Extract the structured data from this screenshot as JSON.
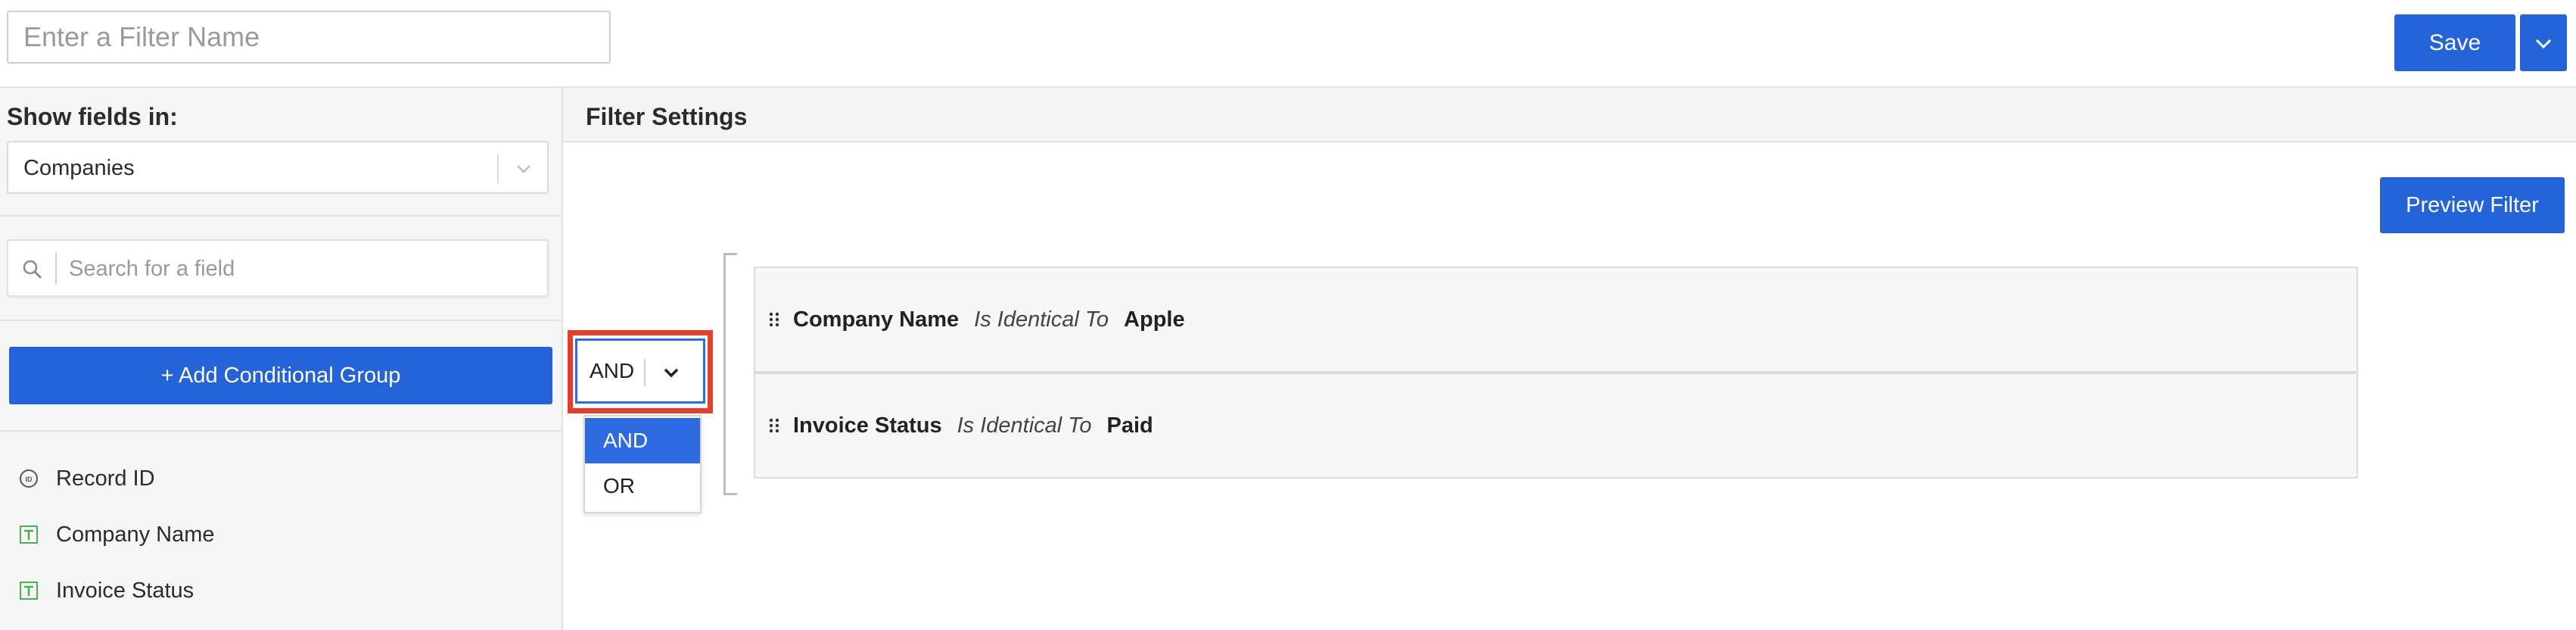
{
  "header": {
    "filter_name_placeholder": "Enter a Filter Name",
    "filter_name_value": "",
    "save_label": "Save"
  },
  "sidebar": {
    "heading": "Show fields in:",
    "object_select_value": "Companies",
    "search_placeholder": "Search for a field",
    "add_group_label": "+ Add Conditional Group",
    "fields": [
      {
        "label": "Record ID",
        "icon": "id-icon"
      },
      {
        "label": "Company Name",
        "icon": "text-field-icon"
      },
      {
        "label": "Invoice Status",
        "icon": "text-field-icon"
      }
    ]
  },
  "main": {
    "title": "Filter Settings",
    "preview_label": "Preview Filter",
    "logic": {
      "value": "AND",
      "options": [
        "AND",
        "OR"
      ],
      "selected": "AND"
    },
    "conditions": [
      {
        "field": "Company Name",
        "operator": "Is Identical To",
        "value": "Apple"
      },
      {
        "field": "Invoice Status",
        "operator": "Is Identical To",
        "value": "Paid"
      }
    ]
  },
  "colors": {
    "accent": "#2563d9",
    "highlight": "#e2402a",
    "text_field_icon": "#4caf50"
  }
}
